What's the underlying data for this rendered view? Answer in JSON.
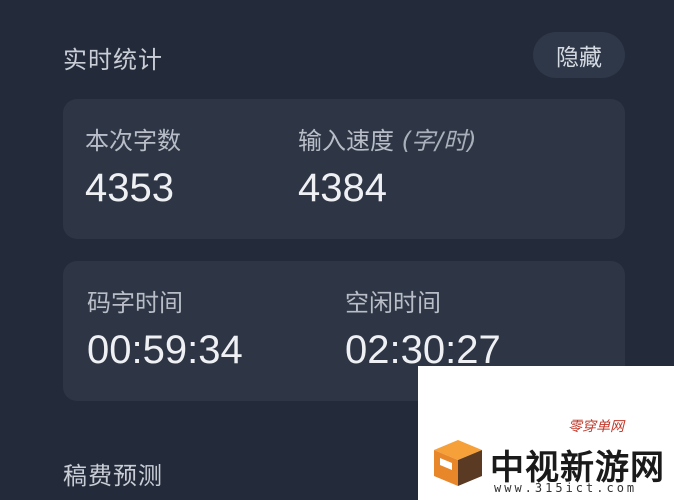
{
  "realtime": {
    "title": "实时统计",
    "hide_label": "隐藏"
  },
  "card1": {
    "word_count_label": "本次字数",
    "word_count_value": "4353",
    "speed_label": "输入速度",
    "speed_unit": "(字/时)",
    "speed_value": "4384"
  },
  "card2": {
    "typing_time_label": "码字时间",
    "typing_time_value": "00:59:34",
    "idle_time_label": "空闲时间",
    "idle_time_value": "02:30:27"
  },
  "manuscript": {
    "title": "稿费预测"
  },
  "watermark": {
    "small_text": "零穿单网",
    "big_text": "中视新游网",
    "url_text": "www.315ict.com"
  }
}
